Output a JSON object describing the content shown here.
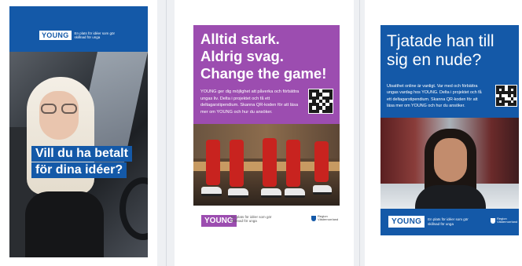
{
  "brand": {
    "logo": "YOUNG",
    "tagline": "En plats för idéer som gör skillnad för unga",
    "region": "Region Västernorrland"
  },
  "posters": [
    {
      "question_lines": [
        "Vill du ha betalt",
        "för dina idéer?"
      ]
    },
    {
      "headline_lines": [
        "Alltid stark.",
        "Aldrig svag.",
        "Change the game!"
      ],
      "body": "YOUNG ger dig möjlighet att påverka och förbättra ungas liv. Delta i projektet och få ett deltagarstipendium. Skanna QR-koden för att läsa mer om YOUNG och hur du ansöker."
    },
    {
      "headline_lines": [
        "Tjatade han till",
        "sig en nude?"
      ],
      "body": "Utsatthet online är vanligt. Var med och förbättra ungas vardag hos YOUNG. Delta i projektet och få ett deltagarstipendium. Skanna QR-koden för att läsa mer om YOUNG och hur du ansöker."
    }
  ],
  "colors": {
    "young_blue": "#1459a8",
    "purple": "#9c4db0",
    "background": "#eef0f3"
  }
}
